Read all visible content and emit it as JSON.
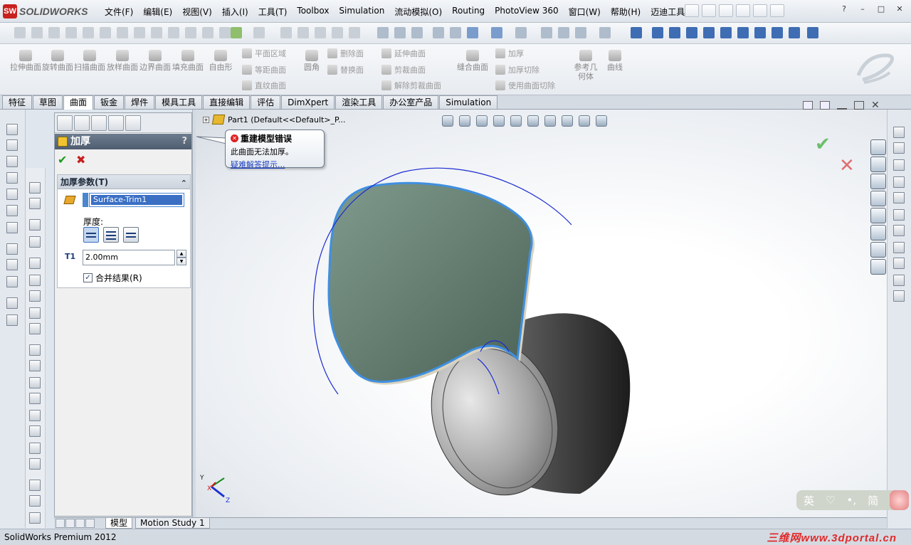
{
  "app": {
    "logo_text": "SOLIDWORKS",
    "logo_mark": "SW",
    "menus": [
      "文件(F)",
      "编辑(E)",
      "视图(V)",
      "插入(I)",
      "工具(T)",
      "Toolbox",
      "Simulation",
      "流动模拟(O)",
      "Routing",
      "PhotoView 360",
      "窗口(W)",
      "帮助(H)",
      "迈迪工具集"
    ],
    "window_controls": [
      "?",
      "–",
      "□",
      "✕"
    ]
  },
  "command_manager": {
    "big_buttons": [
      "拉伸曲面",
      "旋转曲面",
      "扫描曲面",
      "放样曲面",
      "边界曲面",
      "填充曲面",
      "自由形"
    ],
    "col1": [
      "平面区域",
      "等距曲面",
      "直纹曲面"
    ],
    "col2": [
      "删除面",
      "替换面"
    ],
    "round": "圆角",
    "col3": [
      "延伸曲面",
      "剪裁曲面",
      "解除剪裁曲面"
    ],
    "knit": "缝合曲面",
    "col4": [
      "加厚",
      "加厚切除",
      "使用曲面切除"
    ],
    "ref_geom": "参考几何体",
    "curves": "曲线"
  },
  "tabs": [
    "特征",
    "草图",
    "曲面",
    "钣金",
    "焊件",
    "模具工具",
    "直接编辑",
    "评估",
    "DimXpert",
    "渲染工具",
    "办公室产品",
    "Simulation"
  ],
  "active_tab": "曲面",
  "property_manager": {
    "title": "加厚",
    "help": "?",
    "group_title": "加厚参数(T)",
    "surface_selection": "Surface-Trim1",
    "thickness_label": "厚度:",
    "dim_label": "T1",
    "thickness_value": "2.00mm",
    "merge_label": "合并结果(R)",
    "merge_checked": true
  },
  "tree": {
    "part_label": "Part1  (Default<<Default>_P..."
  },
  "tooltip": {
    "title": "重建模型错误",
    "message": "此曲面无法加厚。",
    "link": "疑难解答提示..."
  },
  "bottom_tabs": [
    "模型",
    "Motion Study 1"
  ],
  "status": {
    "text": "SolidWorks Premium 2012",
    "watermark": "三维网www.3dportal.cn"
  },
  "ime": {
    "lang": "英",
    "heart": "♡",
    "punct": "•,",
    "simp": "简"
  },
  "triad": {
    "x": "X",
    "y": "Y",
    "z": "Z"
  },
  "colors": {
    "surface_fill": "#6f8b7d",
    "surface_edge": "#3f8fe0",
    "curve": "#1a2bd1",
    "accent": "#3a6fc4"
  }
}
